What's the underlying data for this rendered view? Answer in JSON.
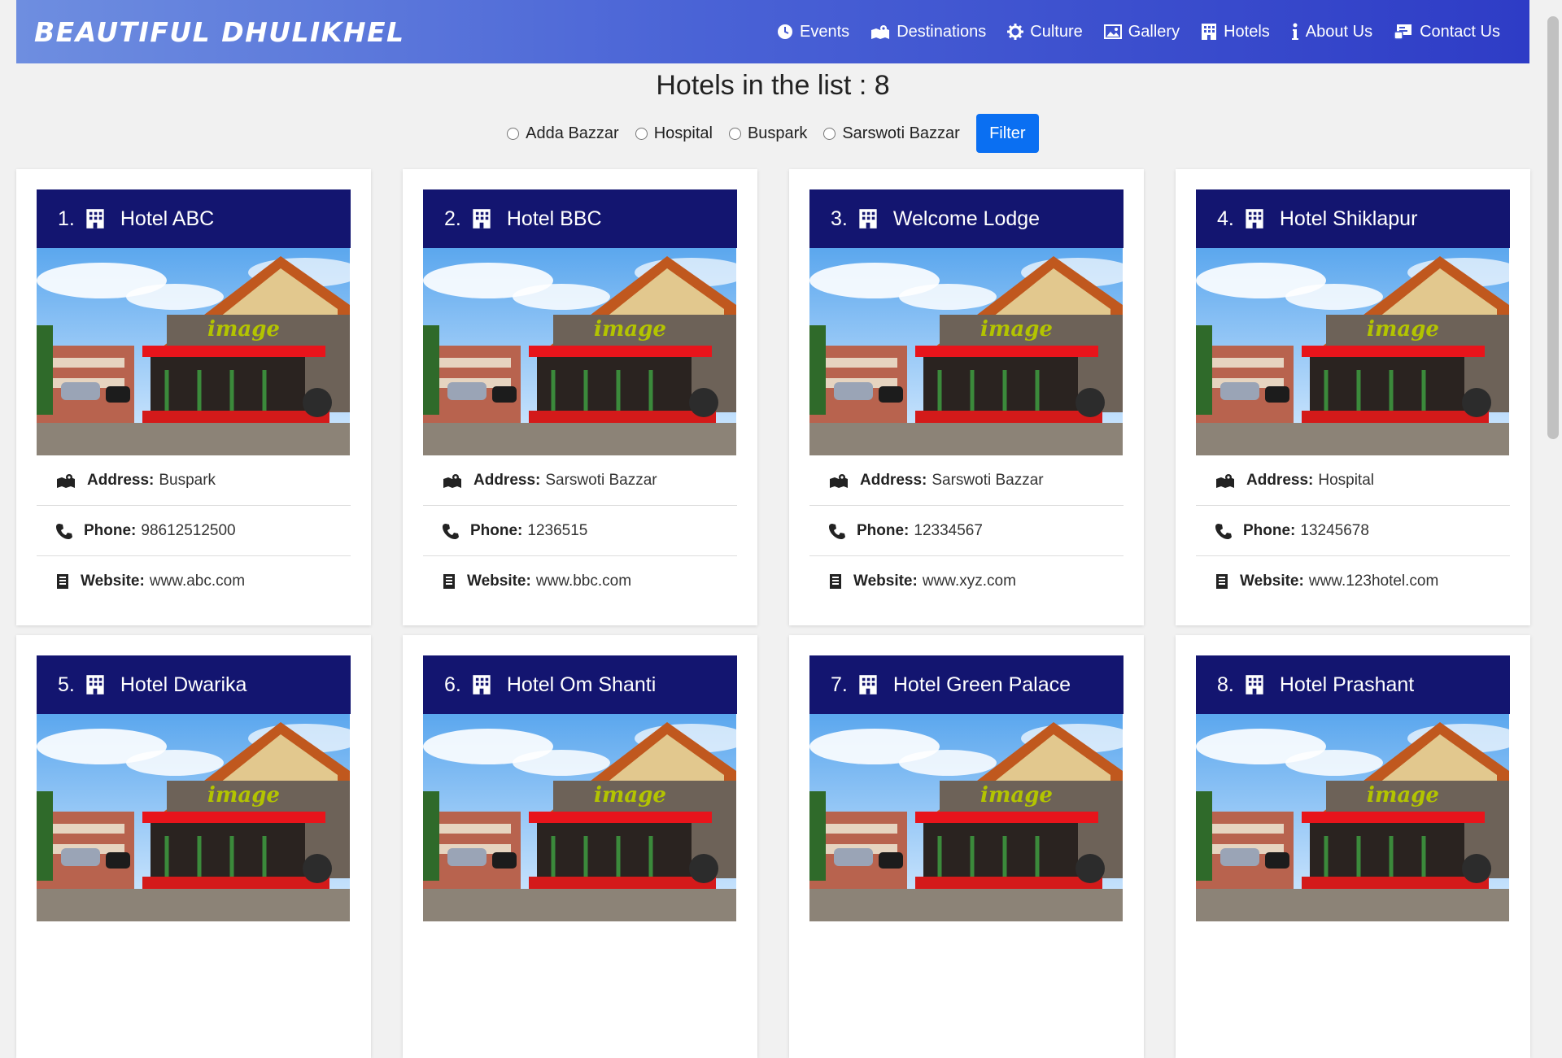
{
  "brand": "BEAUTIFUL DHULIKHEL",
  "nav": [
    {
      "label": "Events",
      "icon": "clock-icon"
    },
    {
      "label": "Destinations",
      "icon": "map-icon"
    },
    {
      "label": "Culture",
      "icon": "gear-icon"
    },
    {
      "label": "Gallery",
      "icon": "image-icon"
    },
    {
      "label": "Hotels",
      "icon": "building-icon"
    },
    {
      "label": "About Us",
      "icon": "info-icon"
    },
    {
      "label": "Contact Us",
      "icon": "contact-icon"
    }
  ],
  "heading": "Hotels in the list : 8",
  "filters": [
    "Adda Bazzar",
    "Hospital",
    "Buspark",
    "Sarswoti Bazzar"
  ],
  "filter_button": "Filter",
  "labels": {
    "address": "Address:",
    "phone": "Phone:",
    "website": "Website:"
  },
  "image_sign": "image",
  "hotels": [
    {
      "num": "1.",
      "name": "Hotel ABC",
      "address": "Buspark",
      "phone": "98612512500",
      "website": "www.abc.com"
    },
    {
      "num": "2.",
      "name": "Hotel BBC",
      "address": "Sarswoti Bazzar",
      "phone": "1236515",
      "website": "www.bbc.com"
    },
    {
      "num": "3.",
      "name": "Welcome Lodge",
      "address": "Sarswoti Bazzar",
      "phone": "12334567",
      "website": "www.xyz.com"
    },
    {
      "num": "4.",
      "name": "Hotel Shiklapur",
      "address": "Hospital",
      "phone": "13245678",
      "website": "www.123hotel.com"
    },
    {
      "num": "5.",
      "name": "Hotel Dwarika"
    },
    {
      "num": "6.",
      "name": "Hotel Om Shanti"
    },
    {
      "num": "7.",
      "name": "Hotel Green Palace"
    },
    {
      "num": "8.",
      "name": "Hotel Prashant"
    }
  ]
}
